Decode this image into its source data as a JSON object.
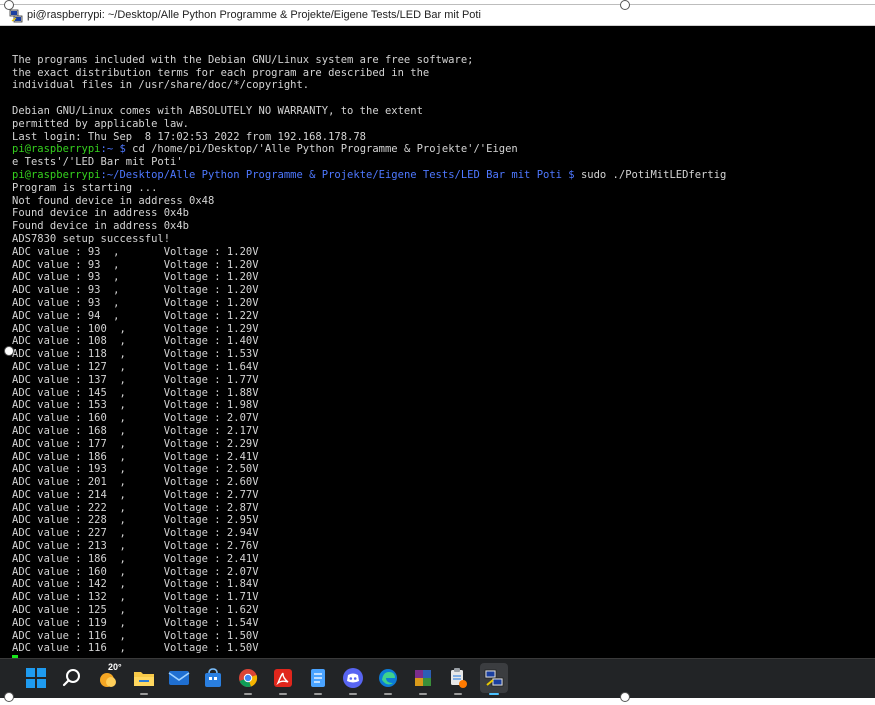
{
  "window": {
    "title": "pi@raspberrypi: ~/Desktop/Alle Python Programme & Projekte/Eigene Tests/LED Bar mit Poti",
    "icon": "putty-icon"
  },
  "terminal": {
    "colors": {
      "background": "#000000",
      "text": "#d4d4d4",
      "user_host": "#35d11e",
      "path": "#4e78ff",
      "cursor": "#18e71c"
    },
    "lines": [
      [
        {
          "t": ""
        }
      ],
      [
        {
          "t": "The programs included with the Debian GNU/Linux system are free software;"
        }
      ],
      [
        {
          "t": "the exact distribution terms for each program are described in the"
        }
      ],
      [
        {
          "t": "individual files in /usr/share/doc/*/copyright."
        }
      ],
      [
        {
          "t": ""
        }
      ],
      [
        {
          "t": "Debian GNU/Linux comes with ABSOLUTELY NO WARRANTY, to the extent"
        }
      ],
      [
        {
          "t": "permitted by applicable law."
        }
      ],
      [
        {
          "t": "Last login: Thu Sep  8 17:02:53 2022 from 192.168.178.78"
        }
      ],
      [
        {
          "t": "pi@raspberrypi",
          "c": "green"
        },
        {
          "t": ":~ $ ",
          "c": "blue"
        },
        {
          "t": "cd /home/pi/Desktop/'Alle Python Programme & Projekte'/'Eigen"
        }
      ],
      [
        {
          "t": "e Tests'/'LED Bar mit Poti'"
        }
      ],
      [
        {
          "t": "pi@raspberrypi",
          "c": "green"
        },
        {
          "t": ":~/Desktop/Alle Python Programme & Projekte/Eigene Tests/LED Bar mit Poti $ ",
          "c": "blue"
        },
        {
          "t": "sudo ./PotiMitLEDfertig"
        }
      ],
      [
        {
          "t": "Program is starting ..."
        }
      ],
      [
        {
          "t": "Not found device in address 0x48"
        }
      ],
      [
        {
          "t": "Found device in address 0x4b"
        }
      ],
      [
        {
          "t": "Found device in address 0x4b"
        }
      ],
      [
        {
          "t": "ADS7830 setup successful!"
        }
      ],
      [
        {
          "t": "ADC value : 93  ,       Voltage : 1.20V"
        }
      ],
      [
        {
          "t": "ADC value : 93  ,       Voltage : 1.20V"
        }
      ],
      [
        {
          "t": "ADC value : 93  ,       Voltage : 1.20V"
        }
      ],
      [
        {
          "t": "ADC value : 93  ,       Voltage : 1.20V"
        }
      ],
      [
        {
          "t": "ADC value : 93  ,       Voltage : 1.20V"
        }
      ],
      [
        {
          "t": "ADC value : 94  ,       Voltage : 1.22V"
        }
      ],
      [
        {
          "t": "ADC value : 100  ,      Voltage : 1.29V"
        }
      ],
      [
        {
          "t": "ADC value : 108  ,      Voltage : 1.40V"
        }
      ],
      [
        {
          "t": "ADC value : 118  ,      Voltage : 1.53V"
        }
      ],
      [
        {
          "t": "ADC value : 127  ,      Voltage : 1.64V"
        }
      ],
      [
        {
          "t": "ADC value : 137  ,      Voltage : 1.77V"
        }
      ],
      [
        {
          "t": "ADC value : 145  ,      Voltage : 1.88V"
        }
      ],
      [
        {
          "t": "ADC value : 153  ,      Voltage : 1.98V"
        }
      ],
      [
        {
          "t": "ADC value : 160  ,      Voltage : 2.07V"
        }
      ],
      [
        {
          "t": "ADC value : 168  ,      Voltage : 2.17V"
        }
      ],
      [
        {
          "t": "ADC value : 177  ,      Voltage : 2.29V"
        }
      ],
      [
        {
          "t": "ADC value : 186  ,      Voltage : 2.41V"
        }
      ],
      [
        {
          "t": "ADC value : 193  ,      Voltage : 2.50V"
        }
      ],
      [
        {
          "t": "ADC value : 201  ,      Voltage : 2.60V"
        }
      ],
      [
        {
          "t": "ADC value : 214  ,      Voltage : 2.77V"
        }
      ],
      [
        {
          "t": "ADC value : 222  ,      Voltage : 2.87V"
        }
      ],
      [
        {
          "t": "ADC value : 228  ,      Voltage : 2.95V"
        }
      ],
      [
        {
          "t": "ADC value : 227  ,      Voltage : 2.94V"
        }
      ],
      [
        {
          "t": "ADC value : 213  ,      Voltage : 2.76V"
        }
      ],
      [
        {
          "t": "ADC value : 186  ,      Voltage : 2.41V"
        }
      ],
      [
        {
          "t": "ADC value : 160  ,      Voltage : 2.07V"
        }
      ],
      [
        {
          "t": "ADC value : 142  ,      Voltage : 1.84V"
        }
      ],
      [
        {
          "t": "ADC value : 132  ,      Voltage : 1.71V"
        }
      ],
      [
        {
          "t": "ADC value : 125  ,      Voltage : 1.62V"
        }
      ],
      [
        {
          "t": "ADC value : 119  ,      Voltage : 1.54V"
        }
      ],
      [
        {
          "t": "ADC value : 116  ,      Voltage : 1.50V"
        }
      ],
      [
        {
          "t": "ADC value : 116  ,      Voltage : 1.50V"
        }
      ]
    ]
  },
  "taskbar": {
    "background": "#222426",
    "items": [
      {
        "name": "start-button",
        "icon": "windows-logo-icon",
        "running": false
      },
      {
        "name": "search-button",
        "icon": "search-icon",
        "running": false
      },
      {
        "name": "weather-widget",
        "icon": "weather-icon",
        "badge": "20°",
        "running": false
      },
      {
        "name": "file-explorer-button",
        "icon": "folder-icon",
        "running": true
      },
      {
        "name": "mail-button",
        "icon": "mail-icon",
        "running": false
      },
      {
        "name": "store-button",
        "icon": "store-icon",
        "running": false
      },
      {
        "name": "chrome-button",
        "icon": "chrome-icon",
        "running": true
      },
      {
        "name": "acrobat-button",
        "icon": "acrobat-icon",
        "running": true
      },
      {
        "name": "notepad-button",
        "icon": "notepad-icon",
        "running": true
      },
      {
        "name": "discord-button",
        "icon": "discord-icon",
        "running": true
      },
      {
        "name": "edge-button",
        "icon": "edge-icon",
        "running": true
      },
      {
        "name": "winrar-button",
        "icon": "winrar-icon",
        "running": true
      },
      {
        "name": "clipboard-app-button",
        "icon": "clipboard-app-icon",
        "running": true
      },
      {
        "name": "putty-button",
        "icon": "putty-icon",
        "running": true,
        "active": true
      }
    ]
  }
}
